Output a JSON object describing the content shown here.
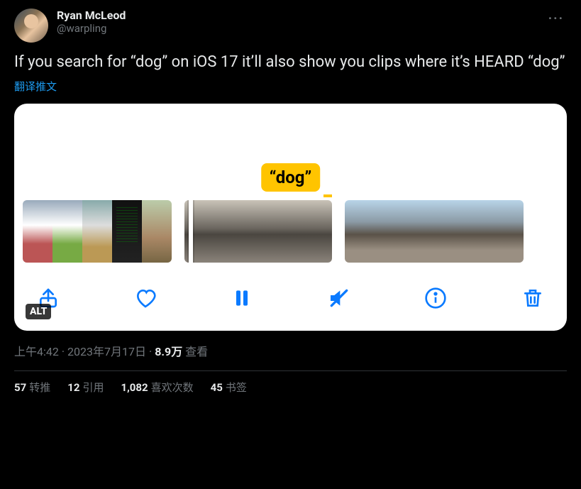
{
  "author": {
    "display_name": "Ryan McLeod",
    "handle": "@warpling"
  },
  "body": "If you search for “dog” on iOS 17 it’ll also show you clips where it’s HEARD “dog”",
  "translate_label": "翻译推文",
  "media": {
    "tooltip": "“dog”",
    "alt_badge": "ALT",
    "toolbar": {
      "share": "share",
      "like": "like",
      "pause": "pause",
      "mute": "mute",
      "info": "info",
      "delete": "delete"
    }
  },
  "meta": {
    "time": "上午4:42",
    "date": "2023年7月17日",
    "views_num": "8.9万",
    "views_label": "查看"
  },
  "stats": {
    "retweets": {
      "num": "57",
      "label": "转推"
    },
    "quotes": {
      "num": "12",
      "label": "引用"
    },
    "likes": {
      "num": "1,082",
      "label": "喜欢次数"
    },
    "bookmarks": {
      "num": "45",
      "label": "书签"
    }
  },
  "more_glyph": "···"
}
